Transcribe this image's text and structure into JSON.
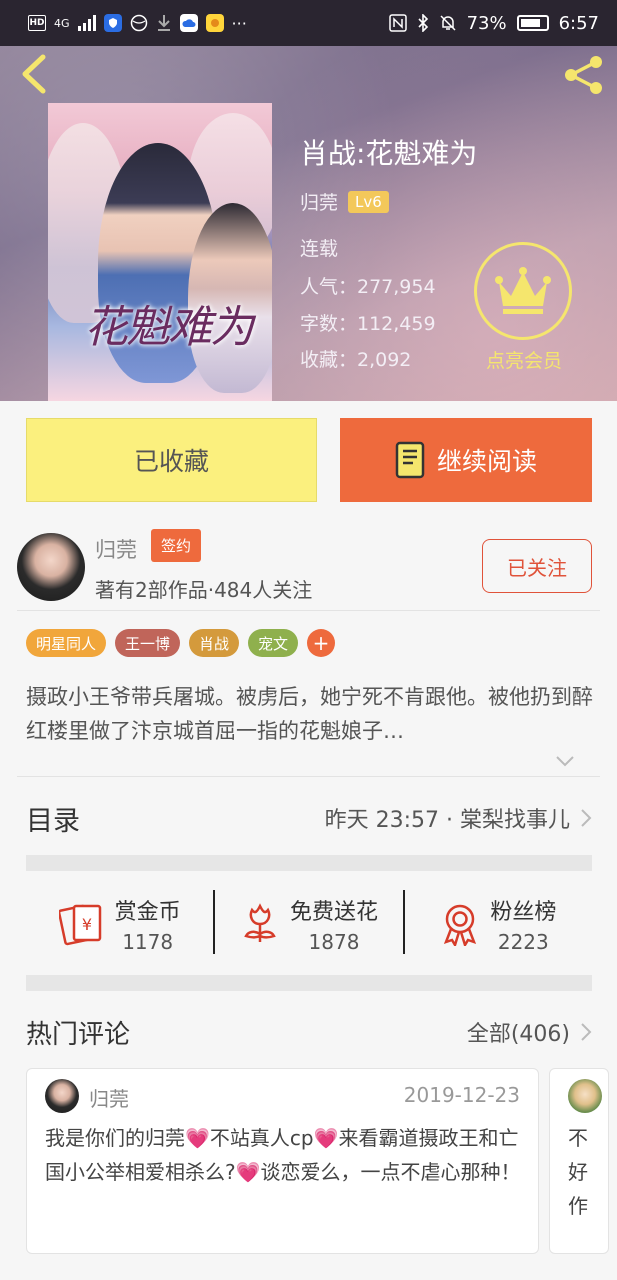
{
  "status_bar": {
    "left_icons": [
      "HD",
      "4G",
      "signal-icon",
      "shield-app-icon",
      "globe-icon",
      "download-icon",
      "cloud-app-icon",
      "weather-app-icon",
      "..."
    ],
    "hd": "HD",
    "net": "4G",
    "more": "···",
    "battery_percent": "73%",
    "time": "6:57"
  },
  "book": {
    "title": "肖战:花魁难为",
    "cover_title": "花魁难为",
    "author": "归莞",
    "level": "Lv6",
    "status": "连载",
    "popularity": "人气：277,954",
    "word_count": "字数：112,459",
    "favorites": "收藏：2,092"
  },
  "vip": {
    "label": "点亮会员"
  },
  "actions": {
    "favorited": "已收藏",
    "continue_reading": "继续阅读"
  },
  "author_card": {
    "name": "归莞",
    "badge": "签约",
    "stats": "著有2部作品·484人关注",
    "follow": "已关注"
  },
  "tags": [
    {
      "label": "明星同人",
      "color": "#f1a63b"
    },
    {
      "label": "王一博",
      "color": "#c0655a"
    },
    {
      "label": "肖战",
      "color": "#d49a3c"
    },
    {
      "label": "宠文",
      "color": "#8fb04d"
    }
  ],
  "tag_more": "+",
  "synopsis": "摄政小王爷带兵屠城。被虏后，她宁死不肯跟他。被他扔到醉红楼里做了汴京城首屈一指的花魁娘子…",
  "toc": {
    "title": "目录",
    "latest": "昨天 23:57 · 棠梨找事儿"
  },
  "gifts": [
    {
      "label": "赏金币",
      "count": "1178",
      "icon": "red-envelope-icon"
    },
    {
      "label": "免费送花",
      "count": "1878",
      "icon": "flower-icon"
    },
    {
      "label": "粉丝榜",
      "count": "2223",
      "icon": "medal-icon"
    }
  ],
  "comments_header": {
    "title": "热门评论",
    "all": "全部(406)"
  },
  "comments": [
    {
      "user": "归莞",
      "date": "2019-12-23",
      "segments": [
        "我是你们的归莞",
        "💗",
        "不站真人cp",
        "💗",
        "来看霸道摄政王和亡国小公举相爱相杀么?",
        "💗",
        "谈恋爱么，一点不虐心那种！"
      ]
    },
    {
      "partial_text": "不好作"
    }
  ]
}
